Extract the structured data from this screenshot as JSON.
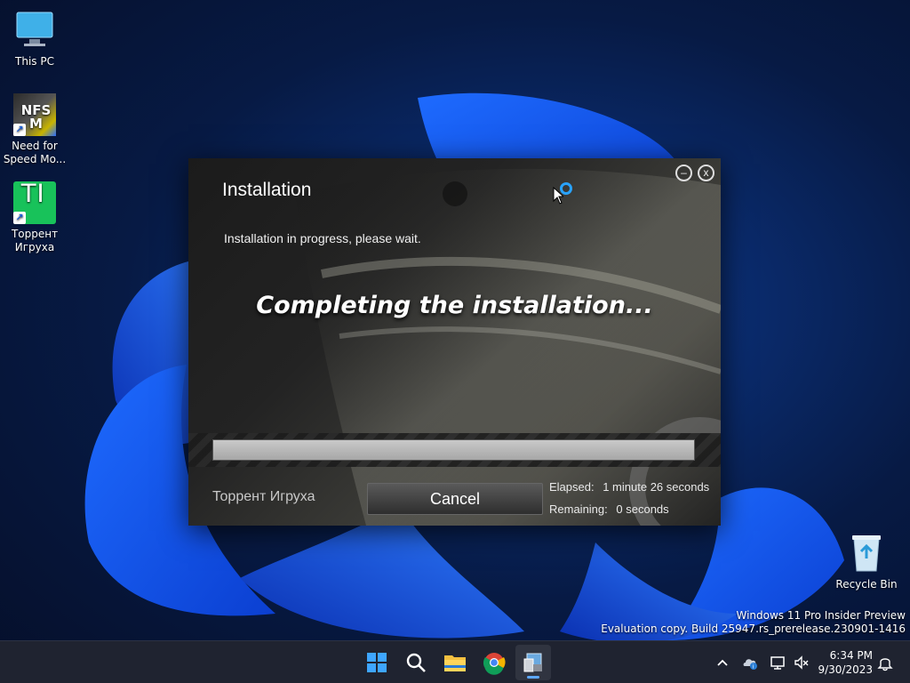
{
  "desktop": {
    "icons": [
      {
        "label": "This PC"
      },
      {
        "label": "Need for Speed Mo...",
        "art_text": "NFS M"
      },
      {
        "label": "Торрент Игруха",
        "art_text": "TI"
      },
      {
        "label": "Recycle Bin"
      }
    ],
    "watermark_line1": "Windows 11 Pro Insider Preview",
    "watermark_line2": "Evaluation copy. Build 25947.rs_prerelease.230901-1416"
  },
  "installer": {
    "title": "Installation",
    "minimize_glyph": "–",
    "close_glyph": "x",
    "subtitle": "Installation in progress, please wait.",
    "status": "Completing the installation...",
    "progress_percent": 100,
    "brand": "Торрент Игруха",
    "cancel_label": "Cancel",
    "elapsed_label": "Elapsed:",
    "elapsed_value": "1 minute 26 seconds",
    "remaining_label": "Remaining:",
    "remaining_value": "0 seconds"
  },
  "taskbar": {
    "apps": [
      {
        "name": "Start",
        "icon": "windows-logo"
      },
      {
        "name": "Search",
        "icon": "search-icon"
      },
      {
        "name": "File Explorer",
        "icon": "folder-icon"
      },
      {
        "name": "Google Chrome",
        "icon": "chrome-icon"
      },
      {
        "name": "Installer",
        "icon": "installer-icon",
        "active": true
      }
    ],
    "clock_time": "6:34 PM",
    "clock_date": "9/30/2023"
  },
  "colors": {
    "accent": "#29a3ff",
    "taskbar_bg": "#1f2330",
    "progress_fill": "#b8b8b8"
  }
}
